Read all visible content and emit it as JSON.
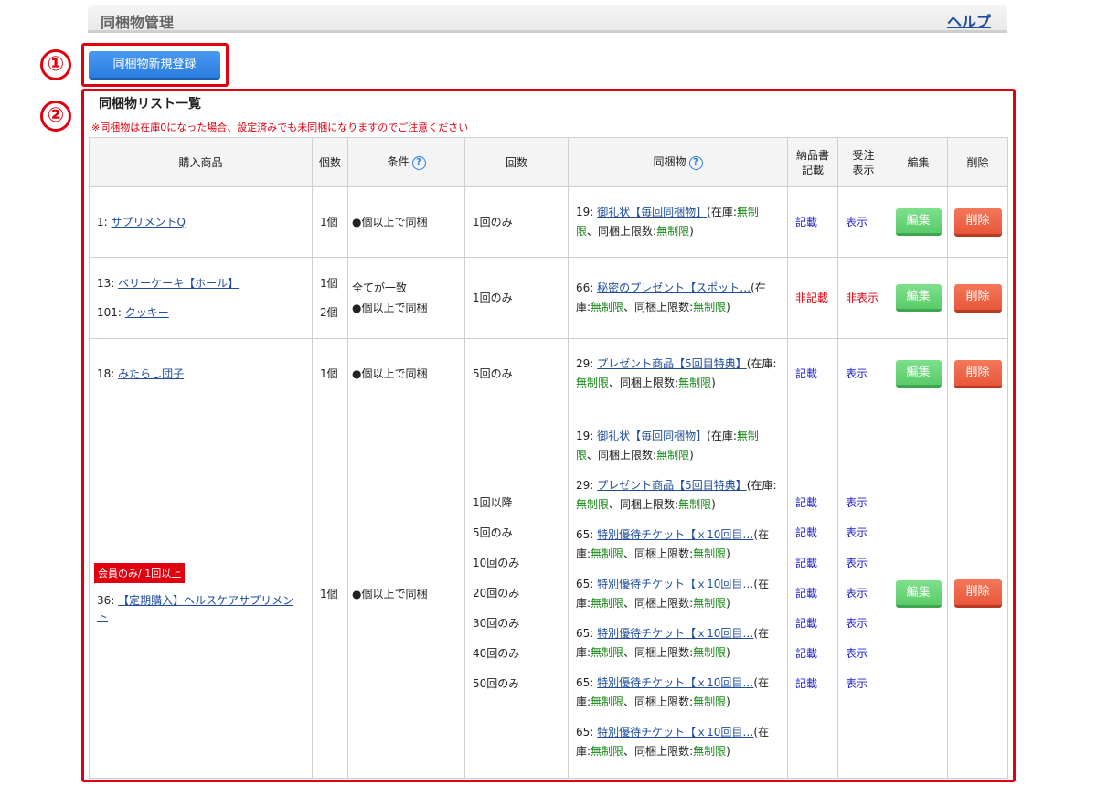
{
  "header": {
    "title": "同梱物管理",
    "help": "ヘルプ"
  },
  "callouts": [
    "①",
    "②"
  ],
  "new_button": "同梱物新規登録",
  "list": {
    "title": "同梱物リスト一覧",
    "note": "※同梱物は在庫0になった場合、設定済みでも未同梱になりますのでご注意ください"
  },
  "columns": {
    "product": "購入商品",
    "count": "個数",
    "condition": "条件",
    "times": "回数",
    "bundle": "同梱物",
    "invoice_1": "納品書",
    "invoice_2": "記載",
    "order_1": "受注",
    "order_2": "表示",
    "edit": "編集",
    "delete": "削除"
  },
  "labels": {
    "stock_open": "(在庫:",
    "stock_unlimited": "無制限",
    "limit_label": "、同梱上限数:",
    "close": ")",
    "edit": "編集",
    "delete": "削除"
  },
  "rows": [
    {
      "items": [
        {
          "id": "1: ",
          "name": "サプリメントQ",
          "count": "1個"
        }
      ],
      "condition": [
        "●個以上で同梱"
      ],
      "times": [
        "1回のみ"
      ],
      "bundles": [
        {
          "id": "19: ",
          "name": "御礼状【毎回同梱物】"
        }
      ],
      "invoice": [
        "記載"
      ],
      "order": [
        "表示"
      ]
    },
    {
      "items": [
        {
          "id": "13: ",
          "name": "ベリーケーキ【ホール】",
          "count": "1個"
        },
        {
          "id": "101: ",
          "name": "クッキー",
          "count": "2個"
        }
      ],
      "condition": [
        "全てが一致",
        "●個以上で同梱"
      ],
      "times": [
        "1回のみ"
      ],
      "bundles": [
        {
          "id": "66: ",
          "name": "秘密のプレゼント【スポット…"
        }
      ],
      "invoice": [
        "非記載"
      ],
      "order": [
        "非表示"
      ]
    },
    {
      "items": [
        {
          "id": "18: ",
          "name": "みたらし団子",
          "count": "1個"
        }
      ],
      "condition": [
        "●個以上で同梱"
      ],
      "times": [
        "5回のみ"
      ],
      "bundles": [
        {
          "id": "29: ",
          "name": "プレゼント商品【5回目特典】"
        }
      ],
      "invoice": [
        "記載"
      ],
      "order": [
        "表示"
      ]
    },
    {
      "badge": "会員のみ/ 1回以上",
      "items": [
        {
          "id": "36: ",
          "name": "【定期購入】ヘルスケアサプリメント",
          "count": "1個"
        }
      ],
      "condition": [
        "●個以上で同梱"
      ],
      "times": [
        "1回以降",
        "5回のみ",
        "10回のみ",
        "20回のみ",
        "30回のみ",
        "40回のみ",
        "50回のみ"
      ],
      "bundles": [
        {
          "id": "19: ",
          "name": "御礼状【毎回同梱物】"
        },
        {
          "id": "29: ",
          "name": "プレゼント商品【5回目特典】"
        },
        {
          "id": "65: ",
          "name": "特別優待チケット【ｘ10回目…"
        },
        {
          "id": "65: ",
          "name": "特別優待チケット【ｘ10回目…"
        },
        {
          "id": "65: ",
          "name": "特別優待チケット【ｘ10回目…"
        },
        {
          "id": "65: ",
          "name": "特別優待チケット【ｘ10回目…"
        },
        {
          "id": "65: ",
          "name": "特別優待チケット【ｘ10回目…"
        }
      ],
      "invoice": [
        "記載",
        "記載",
        "記載",
        "記載",
        "記載",
        "記載",
        "記載"
      ],
      "order": [
        "表示",
        "表示",
        "表示",
        "表示",
        "表示",
        "表示",
        "表示"
      ]
    }
  ],
  "colors": {
    "accent_red": "#e0000f",
    "primary_blue": "#2a7de0",
    "edit_green": "#5acb6a",
    "delete_orange": "#e8563a",
    "stock_green": "#1a8a1a"
  }
}
